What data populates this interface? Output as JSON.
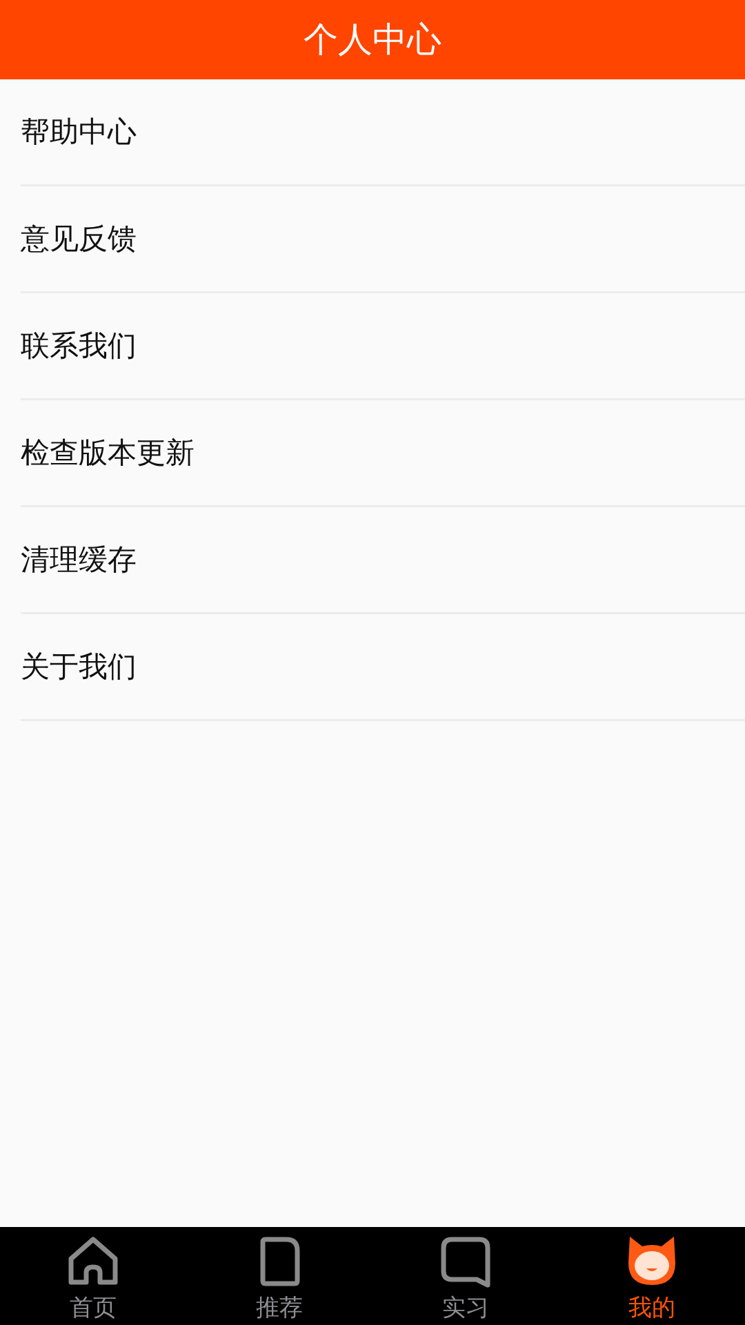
{
  "header": {
    "title": "个人中心"
  },
  "menu": [
    {
      "label": "帮助中心"
    },
    {
      "label": "意见反馈"
    },
    {
      "label": "联系我们"
    },
    {
      "label": "检查版本更新"
    },
    {
      "label": "清理缓存"
    },
    {
      "label": "关于我们"
    }
  ],
  "tab_bar": [
    {
      "label": "首页",
      "selected": false
    },
    {
      "label": "推荐",
      "selected": false
    },
    {
      "label": "实习",
      "selected": false
    },
    {
      "label": "我的",
      "selected": true
    }
  ]
}
